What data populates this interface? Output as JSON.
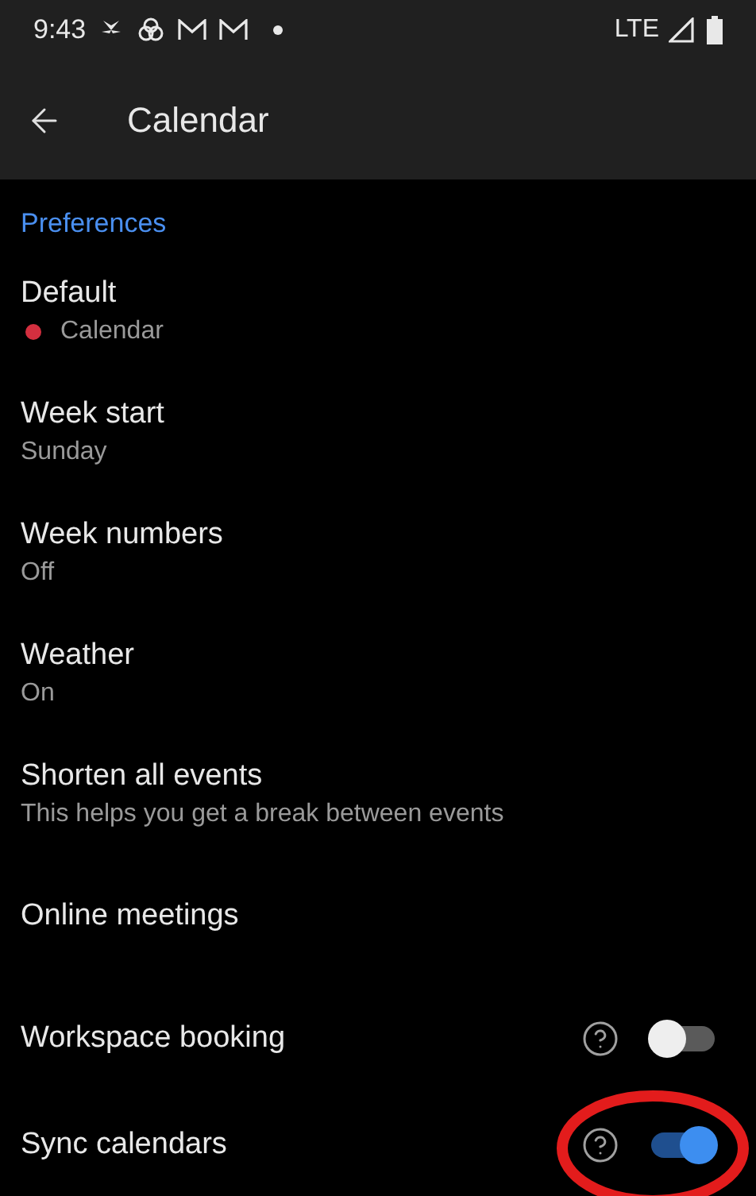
{
  "status_bar": {
    "time": "9:43",
    "network": "LTE"
  },
  "app_bar": {
    "title": "Calendar"
  },
  "section": {
    "title": "Preferences"
  },
  "items": [
    {
      "kind": "value",
      "title": "Default",
      "subtitle": "Calendar",
      "color": "#d32f3f"
    },
    {
      "kind": "value",
      "title": "Week start",
      "subtitle": "Sunday"
    },
    {
      "kind": "value",
      "title": "Week numbers",
      "subtitle": "Off"
    },
    {
      "kind": "value",
      "title": "Weather",
      "subtitle": "On"
    },
    {
      "kind": "value",
      "title": "Shorten all events",
      "subtitle": "This helps you get a break between events"
    },
    {
      "kind": "plain",
      "title": "Online meetings"
    },
    {
      "kind": "toggle",
      "title": "Workspace booking",
      "on": false
    },
    {
      "kind": "toggle",
      "title": "Sync calendars",
      "on": true,
      "annotated": true
    }
  ]
}
